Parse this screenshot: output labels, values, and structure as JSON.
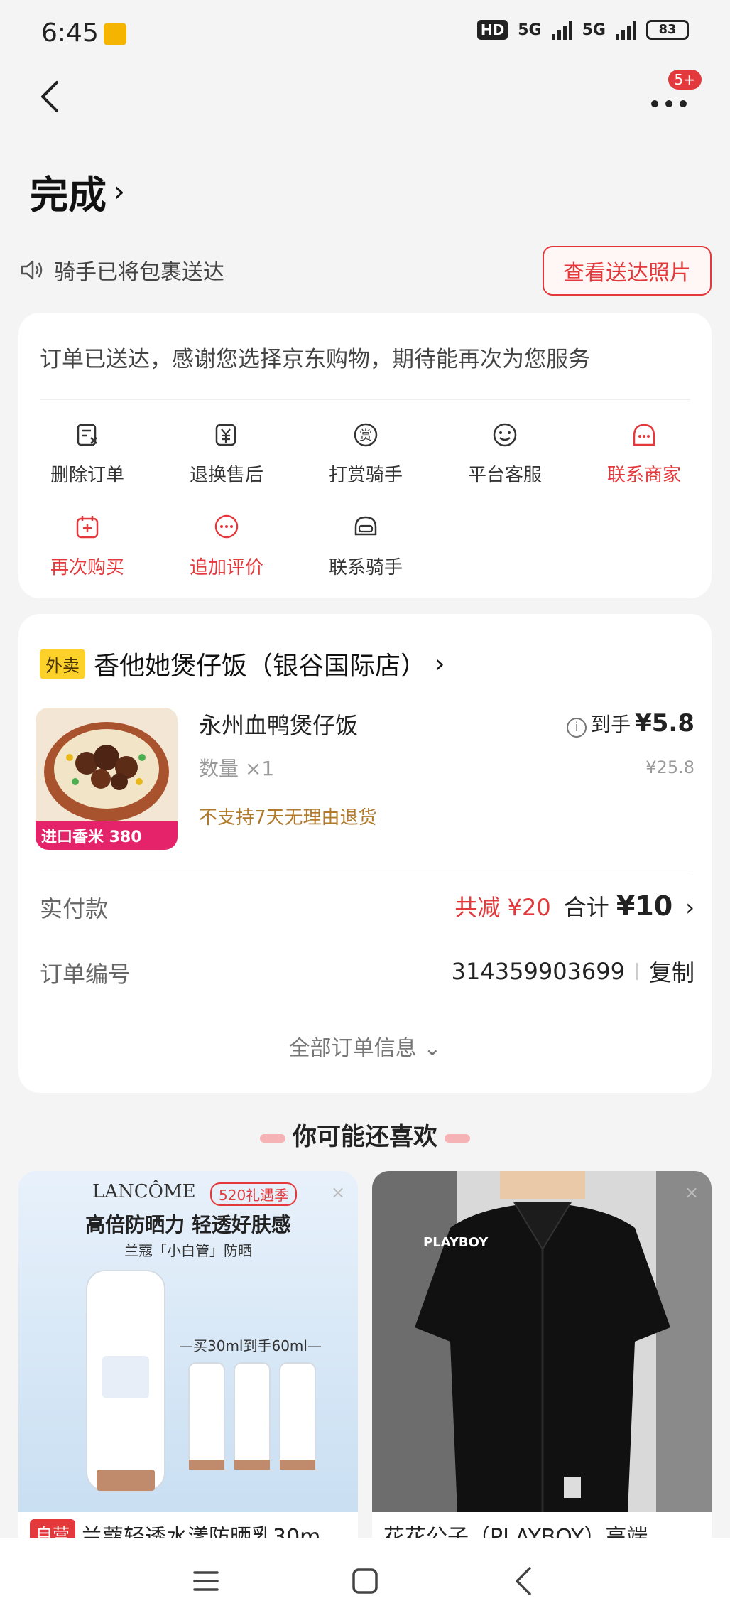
{
  "status_bar": {
    "time": "6:45",
    "hd": "HD",
    "net1": "5G",
    "net2": "5G",
    "battery": "83"
  },
  "nav": {
    "more_badge": "5+"
  },
  "page": {
    "title": "完成",
    "rider_status": "骑手已将包裹送达",
    "view_photo_button": "查看送达照片",
    "thanks_message": "订单已送达，感谢您选择京东购物，期待能再次为您服务"
  },
  "actions": [
    {
      "label": "删除订单",
      "icon": "delete-order-icon",
      "highlight": false
    },
    {
      "label": "退换售后",
      "icon": "refund-icon",
      "highlight": false
    },
    {
      "label": "打赏骑手",
      "icon": "reward-icon",
      "highlight": false
    },
    {
      "label": "平台客服",
      "icon": "customer-service-icon",
      "highlight": false
    },
    {
      "label": "联系商家",
      "icon": "merchant-chat-icon",
      "highlight": true
    },
    {
      "label": "再次购买",
      "icon": "rebuy-icon",
      "highlight": true
    },
    {
      "label": "追加评价",
      "icon": "comment-icon",
      "highlight": true
    },
    {
      "label": "联系骑手",
      "icon": "rider-helmet-icon",
      "highlight": false
    }
  ],
  "order": {
    "tag": "外卖",
    "shop_name": "香他她煲仔饭（银谷国际店）",
    "item_name": "永州血鸭煲仔饭",
    "quantity": "数量 ×1",
    "return_note": "不支持7天无理由退货",
    "price_prefix": "到手",
    "price_now": "¥5.8",
    "price_original": "¥25.8",
    "image_caption": "进口香米 380",
    "paid_label": "实付款",
    "reduced": "共减 ¥20",
    "total_prefix": "合计",
    "total": "¥10",
    "order_no_label": "订单编号",
    "order_no": "314359903699",
    "copy_label": "复制",
    "all_info_label": "全部订单信息"
  },
  "recommend": {
    "title": "你可能还喜欢",
    "items": [
      {
        "brand": "LANCÔME",
        "promo": "520礼遇季",
        "headline": "高倍防晒力 轻透好肤感",
        "sub": "兰蔻「小白管」防晒",
        "deal": "—买30ml到手60ml—",
        "tag": "自营",
        "name": "兰蔻轻透水漾防晒乳30m"
      },
      {
        "brand": "PLAYBOY",
        "name": "花花公子（PLAYBOY）高端"
      }
    ]
  },
  "colors": {
    "accent": "#e4393c",
    "background": "#f4f4f4",
    "card": "#ffffff"
  }
}
